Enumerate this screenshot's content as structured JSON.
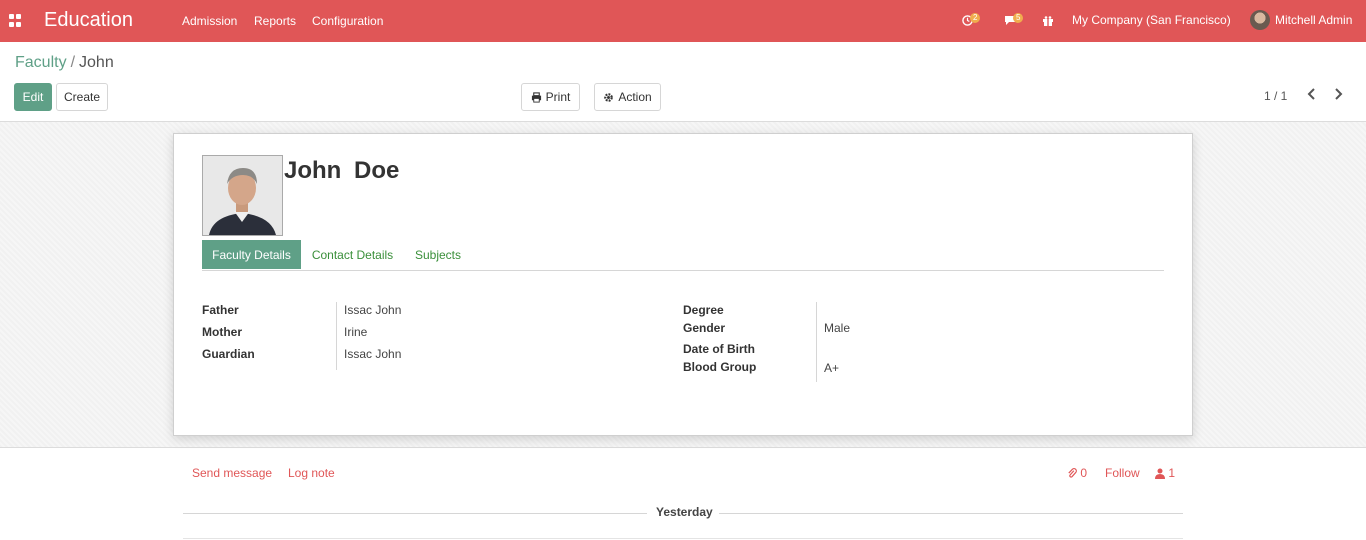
{
  "navbar": {
    "app_name": "Education",
    "menu": [
      "Admission",
      "Reports",
      "Configuration"
    ],
    "activity_count": "2",
    "message_count": "5",
    "company": "My Company (San Francisco)",
    "user": "Mitchell Admin",
    "color": "#e05657"
  },
  "breadcrumb": {
    "parent": "Faculty",
    "separator": "/",
    "current": "John"
  },
  "buttons": {
    "edit": "Edit",
    "create": "Create",
    "print": "Print",
    "action": "Action"
  },
  "pager": {
    "value": "1 / 1"
  },
  "record": {
    "name": "John Doe",
    "tabs": [
      "Faculty Details",
      "Contact Details",
      "Subjects"
    ],
    "left_fields": [
      {
        "label": "Father",
        "value": "Issac John"
      },
      {
        "label": "Mother",
        "value": "Irine"
      },
      {
        "label": "Guardian",
        "value": "Issac John"
      }
    ],
    "right_fields": [
      {
        "label": "Degree",
        "value": ""
      },
      {
        "label": "Gender",
        "value": "Male"
      },
      {
        "label": "Date of Birth",
        "value": ""
      },
      {
        "label": "Blood Group",
        "value": "A+"
      }
    ]
  },
  "chatter": {
    "send_message": "Send message",
    "log_note": "Log note",
    "attachments": "0",
    "follow": "Follow",
    "followers": "1",
    "date_separator": "Yesterday"
  },
  "icons": [
    "apps-icon",
    "clock-icon",
    "comments-icon",
    "gift-icon",
    "print-icon",
    "gear-icon",
    "chevron-left-icon",
    "chevron-right-icon",
    "paperclip-icon",
    "user-icon"
  ]
}
